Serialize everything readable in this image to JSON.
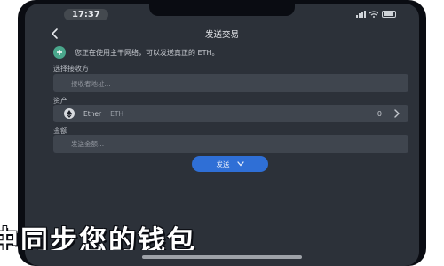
{
  "status": {
    "time": "17:37"
  },
  "nav": {
    "title": "发送交易"
  },
  "notice": {
    "text": "您正在使用主干网络，可以发送真正的 ETH。"
  },
  "recipient": {
    "label": "选择接收方",
    "placeholder": "接收者地址..."
  },
  "asset": {
    "label": "资产",
    "name": "Ether",
    "symbol": "ETH",
    "balance": "0"
  },
  "amount": {
    "label": "金额",
    "placeholder": "发送金额..."
  },
  "send_button": {
    "label": "发送"
  },
  "caption": {
    "text": "中同步您的钱包"
  },
  "colors": {
    "screen_bg": "#2c3139",
    "field_bg": "#3f454e",
    "accent": "#2f6fd6",
    "notice_icon": "#4aa78c"
  }
}
